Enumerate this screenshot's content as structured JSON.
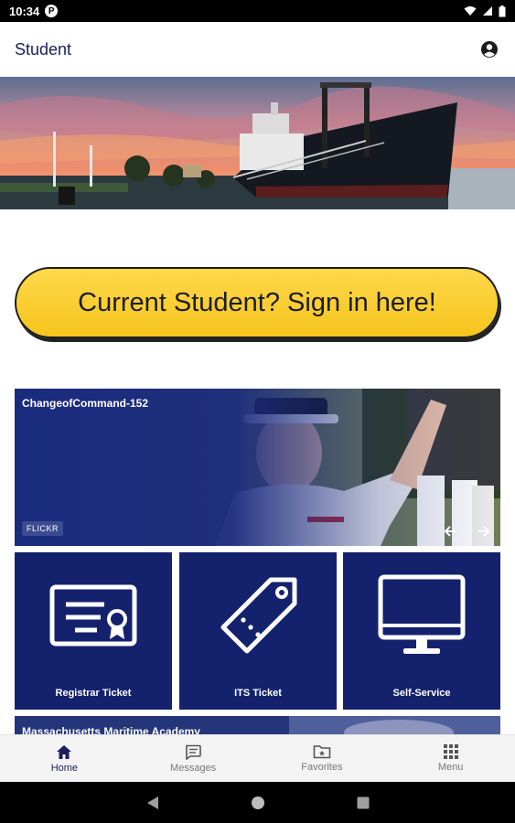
{
  "status_bar": {
    "time": "10:34",
    "app_icon": "P"
  },
  "app_bar": {
    "title": "Student",
    "account_icon": "account-circle-icon"
  },
  "hero": {
    "description_icon": "ship-photo"
  },
  "signin": {
    "label": "Current Student? Sign in here!",
    "color": "#FFD43B"
  },
  "flickr_card": {
    "title": "ChangeofCommand-152",
    "badge": "FLICKR"
  },
  "tiles": [
    {
      "label": "Registrar Ticket",
      "icon": "certificate-icon"
    },
    {
      "label": "ITS Ticket",
      "icon": "tag-icon"
    },
    {
      "label": "Self-Service",
      "icon": "monitor-icon"
    }
  ],
  "partial_card": {
    "title": "Massachusetts Maritime Academy"
  },
  "bottom_nav": [
    {
      "label": "Home",
      "icon": "home-icon",
      "active": true
    },
    {
      "label": "Messages",
      "icon": "messages-icon",
      "active": false
    },
    {
      "label": "Favorites",
      "icon": "favorites-folder-icon",
      "active": false
    },
    {
      "label": "Menu",
      "icon": "grid-menu-icon",
      "active": false
    }
  ],
  "colors": {
    "brand_navy": "#14226E",
    "accent_yellow": "#FFD43B",
    "title_text": "#1A1F5C"
  }
}
